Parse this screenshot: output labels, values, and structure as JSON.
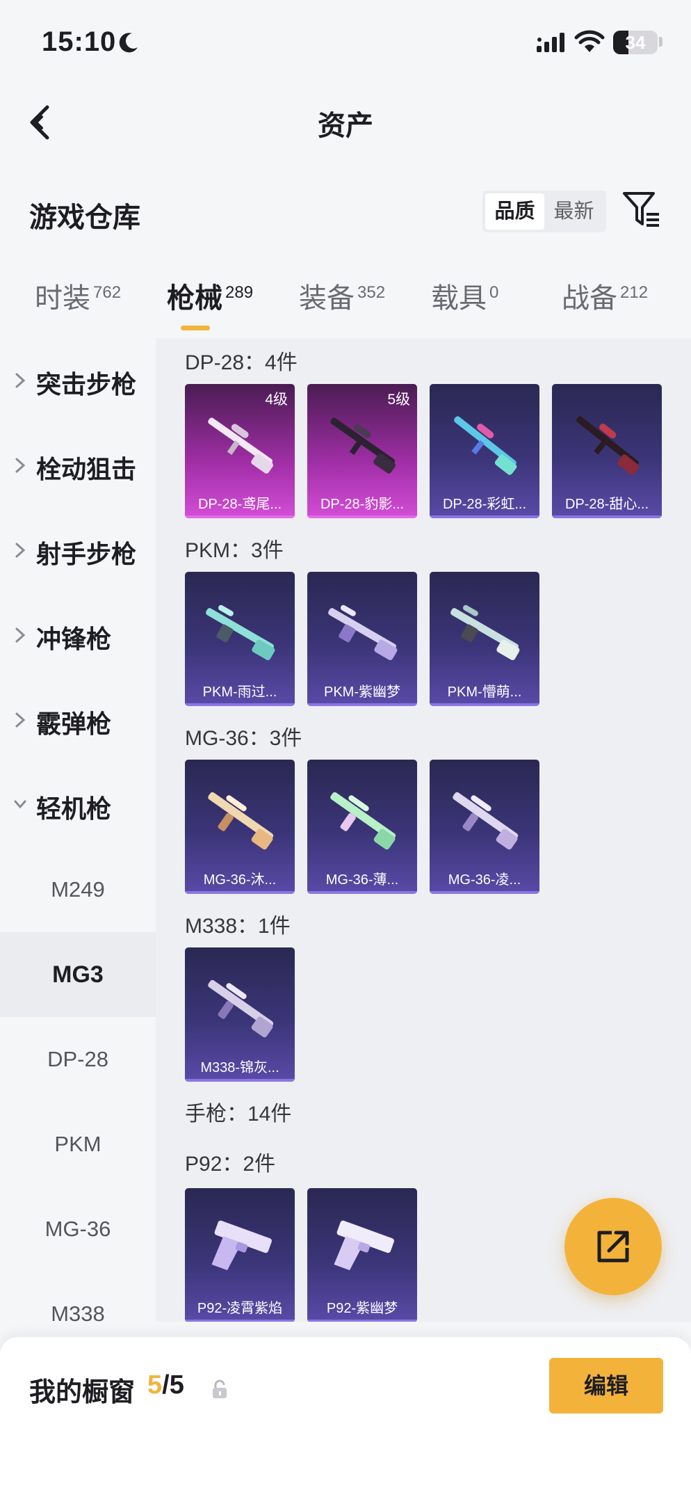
{
  "status_bar": {
    "time": "15:10",
    "battery": "34",
    "battery_level": 0.34
  },
  "header": {
    "title": "资产"
  },
  "section": {
    "title": "游戏仓库"
  },
  "sort": {
    "quality": "品质",
    "latest": "最新"
  },
  "tabs": [
    {
      "label": "时装",
      "count": "762"
    },
    {
      "label": "枪械",
      "count": "289"
    },
    {
      "label": "装备",
      "count": "352"
    },
    {
      "label": "载具",
      "count": "0"
    },
    {
      "label": "战备",
      "count": "212"
    }
  ],
  "sidebar": {
    "categories": [
      "突击步枪",
      "栓动狙击",
      "射手步枪",
      "冲锋枪",
      "霰弹枪",
      "轻机枪"
    ],
    "subitems": [
      "M249",
      "MG3",
      "DP-28",
      "PKM",
      "MG-36",
      "M338"
    ]
  },
  "groups": [
    {
      "title": "DP-28：4件",
      "items": [
        {
          "name": "DP-28-鸢尾...",
          "level": "4级"
        },
        {
          "name": "DP-28-豹影...",
          "level": "5级"
        },
        {
          "name": "DP-28-彩虹..."
        },
        {
          "name": "DP-28-甜心..."
        }
      ]
    },
    {
      "title": "PKM：3件",
      "items": [
        {
          "name": "PKM-雨过..."
        },
        {
          "name": "PKM-紫幽梦"
        },
        {
          "name": "PKM-懵萌..."
        }
      ]
    },
    {
      "title": "MG-36：3件",
      "items": [
        {
          "name": "MG-36-沐..."
        },
        {
          "name": "MG-36-薄..."
        },
        {
          "name": "MG-36-凌..."
        }
      ]
    },
    {
      "title": "M338：1件",
      "items": [
        {
          "name": "M338-锦灰..."
        }
      ]
    },
    {
      "title": "手枪：14件",
      "items": []
    },
    {
      "title": "P92：2件",
      "items": [
        {
          "name": "P92-凌霄紫焰"
        },
        {
          "name": "P92-紫幽梦"
        }
      ]
    }
  ],
  "showcase": {
    "title": "我的橱窗",
    "current": "5",
    "total": "/5",
    "edit_label": "编辑"
  },
  "colors": {
    "accent": "#f1b43c",
    "card_purple": "#3b3578",
    "card_pink": "#a22fa8"
  }
}
